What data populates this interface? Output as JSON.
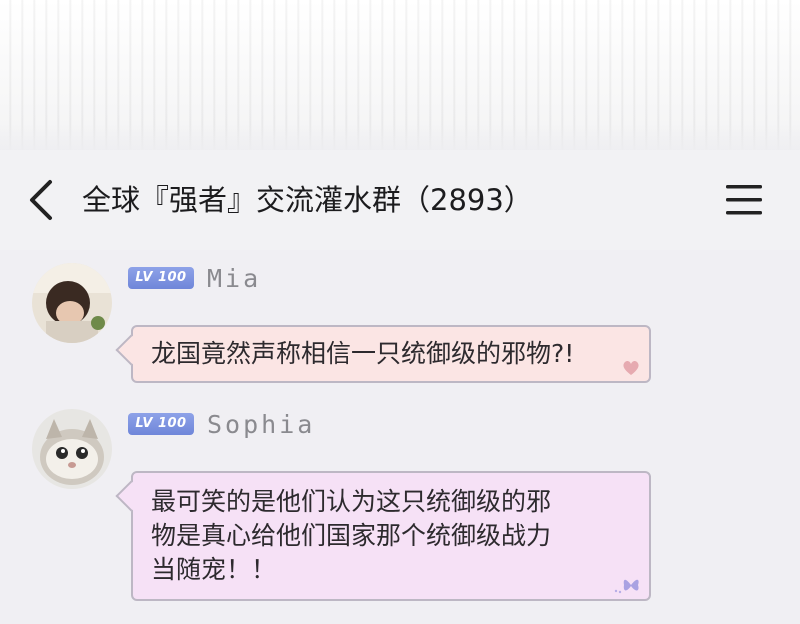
{
  "header": {
    "title": "全球『强者』交流灌水群（2893）",
    "back_icon": "chevron-left-icon",
    "menu_icon": "hamburger-menu-icon"
  },
  "messages": [
    {
      "level": "LV 100",
      "username": "Mia",
      "avatar": "person-avatar",
      "text": "龙国竟然声称相信一只统御级的邪物?!",
      "bubble_color": "#fbe5e4",
      "deco_icon": "heart-icon"
    },
    {
      "level": "LV 100",
      "username": "Sophia",
      "avatar": "cat-avatar",
      "text_lines": [
        "最可笑的是他们认为这只统御级的邪",
        "物是真心给他们国家那个统御级战力",
        "当随宠！！"
      ],
      "bubble_color": "#f6e1f6",
      "deco_icon": "butterfly-icon"
    }
  ],
  "colors": {
    "header_bg": "#f2f2f4",
    "chat_bg": "#f0eff3",
    "badge": "#7a8fe0",
    "bubble_border": "#bdb7c4"
  }
}
